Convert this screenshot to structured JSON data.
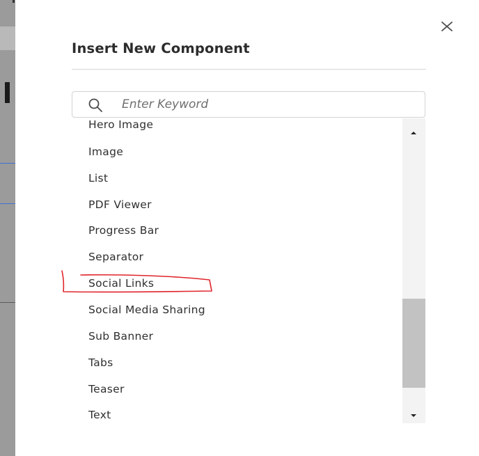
{
  "dialog": {
    "title": "Insert New Component",
    "close_icon": "close-icon"
  },
  "search": {
    "placeholder": "Enter Keyword",
    "value": "",
    "icon": "search-icon"
  },
  "components": {
    "items": [
      {
        "label": "Hero Image"
      },
      {
        "label": "Image"
      },
      {
        "label": "List"
      },
      {
        "label": "PDF Viewer"
      },
      {
        "label": "Progress Bar"
      },
      {
        "label": "Separator"
      },
      {
        "label": "Social Links"
      },
      {
        "label": "Social Media Sharing"
      },
      {
        "label": "Sub Banner"
      },
      {
        "label": "Tabs"
      },
      {
        "label": "Teaser"
      },
      {
        "label": "Text"
      }
    ],
    "highlighted_item": "Social Links"
  },
  "colors": {
    "annotation": "#e0242a",
    "title": "#2c2c2c",
    "scroll_thumb": "#c2c2c2",
    "scroll_track": "#f3f3f3"
  }
}
